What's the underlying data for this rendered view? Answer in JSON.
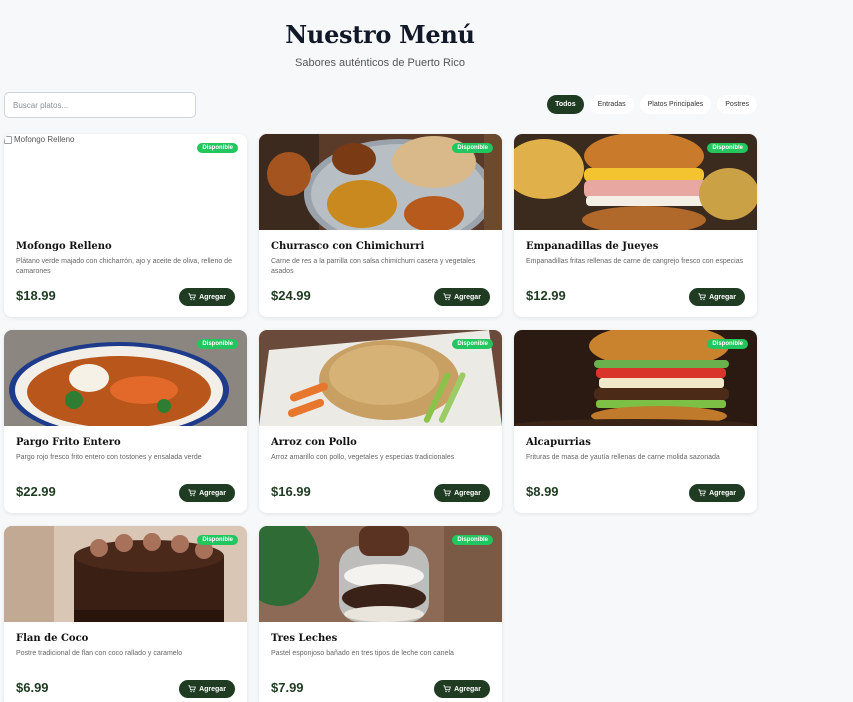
{
  "header": {
    "title": "Nuestro Menú",
    "subtitle": "Sabores auténticos de Puerto Rico"
  },
  "search": {
    "placeholder": "Buscar platos..."
  },
  "filters": [
    {
      "label": "Todos",
      "active": true
    },
    {
      "label": "Entradas",
      "active": false
    },
    {
      "label": "Platos Principales",
      "active": false
    },
    {
      "label": "Postres",
      "active": false
    }
  ],
  "colors": {
    "primary": "#1f3b22",
    "badge": "#22c55e",
    "background": "#f7f8fa"
  },
  "add_label": "Agregar",
  "badge_label": "Disponible",
  "items": [
    {
      "name": "Mofongo Relleno",
      "description": "Plátano verde majado con chicharrón, ajo y aceite de oliva, relleno de camarones",
      "price": "$18.99",
      "image_alt": "Mofongo Relleno"
    },
    {
      "name": "Churrasco con Chimichurri",
      "description": "Carne de res a la parrilla con salsa chimichurri casera y vegetales asados",
      "price": "$24.99"
    },
    {
      "name": "Empanadillas de Jueyes",
      "description": "Empanadillas fritas rellenas de carne de cangrejo fresco con especias",
      "price": "$12.99"
    },
    {
      "name": "Pargo Frito Entero",
      "description": "Pargo rojo fresco frito entero con tostones y ensalada verde",
      "price": "$22.99"
    },
    {
      "name": "Arroz con Pollo",
      "description": "Arroz amarillo con pollo, vegetales y especias tradicionales",
      "price": "$16.99"
    },
    {
      "name": "Alcapurrias",
      "description": "Frituras de masa de yautía rellenas de carne molida sazonada",
      "price": "$8.99"
    },
    {
      "name": "Flan de Coco",
      "description": "Postre tradicional de flan con coco rallado y caramelo",
      "price": "$6.99"
    },
    {
      "name": "Tres Leches",
      "description": "Pastel esponjoso bañado en tres tipos de leche con canela",
      "price": "$7.99"
    }
  ]
}
